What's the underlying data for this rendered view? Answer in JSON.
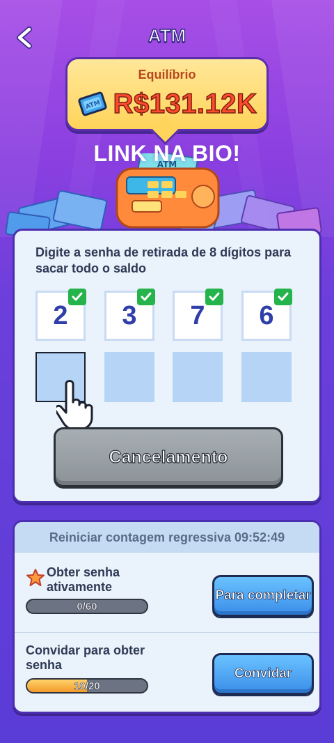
{
  "header": {
    "title": "ATM"
  },
  "balance": {
    "label": "Equilíbrio",
    "value": "R$131.12K"
  },
  "banner": {
    "text": "LINK NA BIO!",
    "machine_label": "ATM"
  },
  "password_panel": {
    "instruction": "Digite a senha de retirada de 8 dígitos para sacar todo o saldo",
    "digits": [
      "2",
      "3",
      "7",
      "6"
    ],
    "cancel_label": "Cancelamento"
  },
  "tasks": {
    "countdown": "Reiniciar contagem regressiva 09:52:49",
    "items": [
      {
        "title": "Obter senha ativamente",
        "progress_text": "0/60",
        "progress_fraction": 0.0,
        "button_label": "Para completar"
      },
      {
        "title": "Convidar para obter senha",
        "progress_text": "10/20",
        "progress_fraction": 0.5,
        "button_label": "Convidar"
      }
    ]
  },
  "colors": {
    "accent_purple": "#5a3cd6",
    "balance_red": "#ff4b2b",
    "check_green": "#25b34b",
    "button_blue": "#3a8ee8"
  },
  "icons": {
    "back": "chevron-left-icon",
    "ticket": "ticket-icon",
    "check": "check-icon",
    "hand": "pointer-hand-icon",
    "star": "star-icon"
  }
}
